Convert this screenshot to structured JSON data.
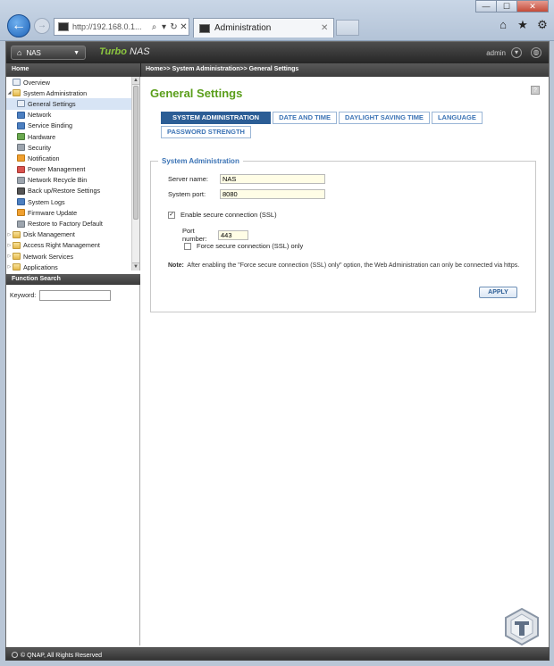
{
  "browser": {
    "url": "http://192.168.0.1...",
    "tab_title": "Administration",
    "window_buttons": [
      "—",
      "☐",
      "✕"
    ],
    "toolbar_icons": [
      "home-icon",
      "star-icon",
      "gear-icon"
    ]
  },
  "topbar": {
    "nas_button": "NAS",
    "brand_bold": "Turbo",
    "brand_rest": " NAS",
    "user": "admin"
  },
  "left_header": "Home",
  "breadcrumb": "Home>> System Administration>> General Settings",
  "sidebar": {
    "items": [
      {
        "label": "Overview"
      },
      {
        "label": "System Administration"
      },
      {
        "label": "General Settings"
      },
      {
        "label": "Network"
      },
      {
        "label": "Service Binding"
      },
      {
        "label": "Hardware"
      },
      {
        "label": "Security"
      },
      {
        "label": "Notification"
      },
      {
        "label": "Power Management"
      },
      {
        "label": "Network Recycle Bin"
      },
      {
        "label": "Back up/Restore Settings"
      },
      {
        "label": "System Logs"
      },
      {
        "label": "Firmware Update"
      },
      {
        "label": "Restore to Factory Default"
      },
      {
        "label": "Disk Management"
      },
      {
        "label": "Access Right Management"
      },
      {
        "label": "Network Services"
      },
      {
        "label": "Applications"
      }
    ]
  },
  "function_search": {
    "title": "Function Search",
    "keyword_label": "Keyword:",
    "keyword_value": ""
  },
  "main": {
    "title": "General Settings",
    "tabs_row1": [
      "SYSTEM ADMINISTRATION",
      "DATE AND TIME",
      "DAYLIGHT SAVING TIME",
      "LANGUAGE"
    ],
    "tabs_row2": [
      "PASSWORD STRENGTH"
    ],
    "section_title": "System Administration",
    "server_name_label": "Server name:",
    "server_name_value": "NAS",
    "system_port_label": "System port:",
    "system_port_value": "8080",
    "ssl_label": "Enable secure connection (SSL)",
    "ssl_checked": true,
    "port_number_label": "Port number:",
    "port_number_value": "443",
    "force_ssl_label": "Force secure connection (SSL) only",
    "force_ssl_checked": false,
    "note_label": "Note:",
    "note_text": "After enabling the \"Force secure connection (SSL) only\" option, the Web Administration can only be connected via https.",
    "apply_label": "APPLY"
  },
  "footer": "© QNAP, All Rights Reserved",
  "colors": {
    "accent_green": "#5a9e1a",
    "tab_blue": "#3b73b5",
    "active_tab": "#2b5d95",
    "header_dark": "#333333"
  }
}
